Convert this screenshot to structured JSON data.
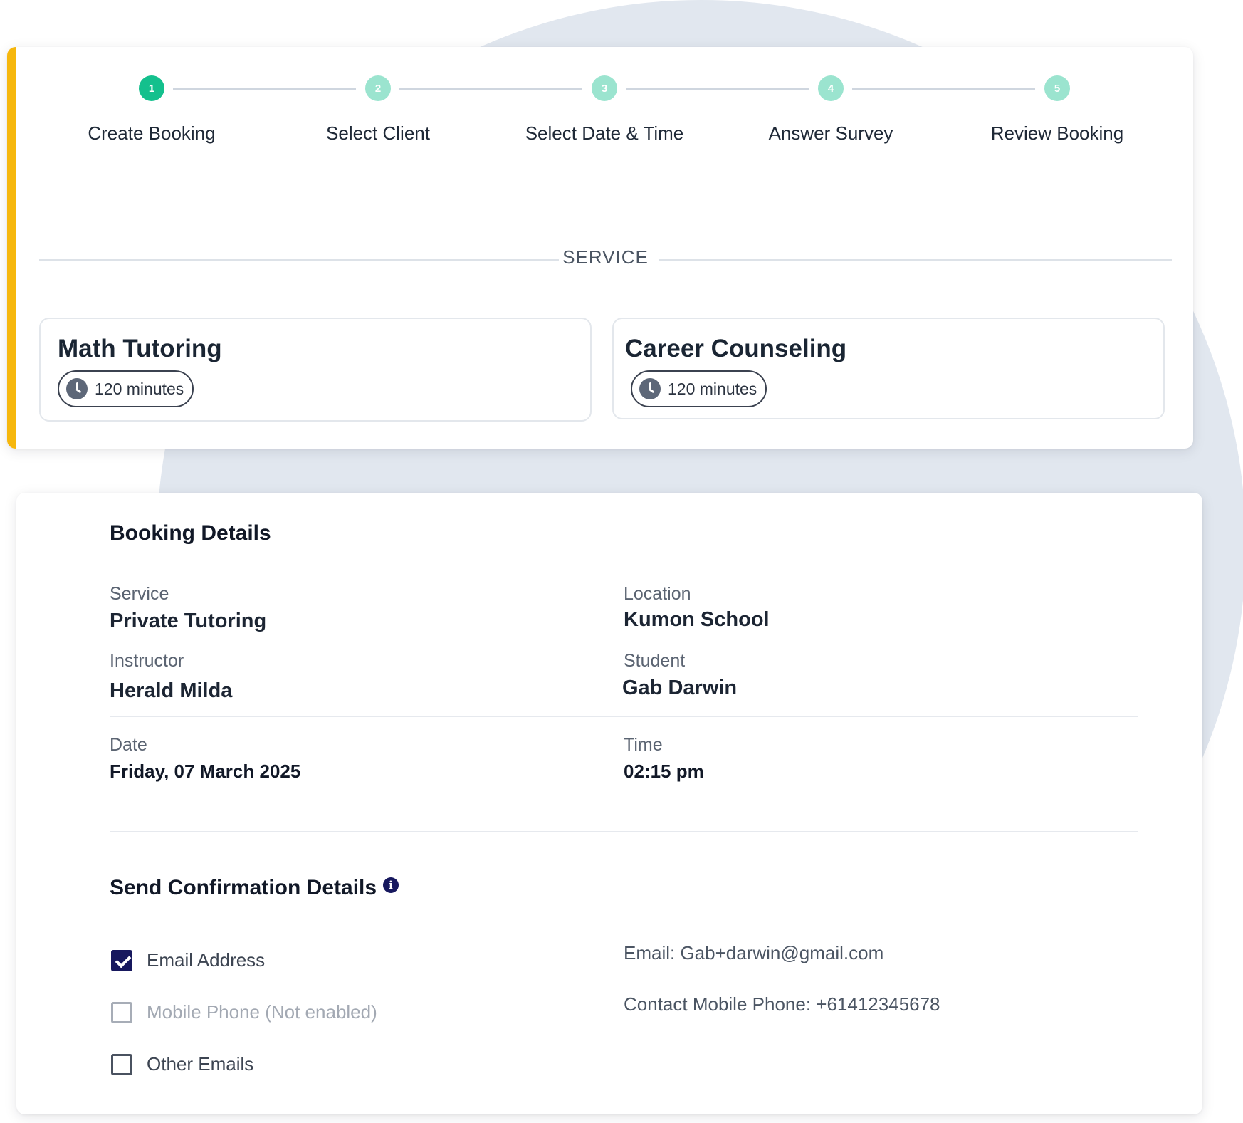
{
  "stepper": {
    "steps": [
      {
        "number": "1",
        "label": "Create Booking",
        "state": "active"
      },
      {
        "number": "2",
        "label": "Select Client",
        "state": "pending"
      },
      {
        "number": "3",
        "label": "Select Date & Time",
        "state": "pending"
      },
      {
        "number": "4",
        "label": "Answer Survey",
        "state": "pending"
      },
      {
        "number": "5",
        "label": "Review Booking",
        "state": "pending"
      }
    ]
  },
  "service_section": {
    "heading": "SERVICE",
    "services": [
      {
        "title": "Math Tutoring",
        "duration": "120 minutes",
        "icon": "clock-icon"
      },
      {
        "title": "Career Counseling",
        "duration": "120 minutes",
        "icon": "clock-icon"
      }
    ]
  },
  "booking_details": {
    "title": "Booking Details",
    "service_label": "Service",
    "service_value": "Private Tutoring",
    "location_label": "Location",
    "location_value": "Kumon School",
    "instructor_label": "Instructor",
    "instructor_value": "Herald Milda",
    "student_label": "Student",
    "student_value": "Gab Darwin",
    "date_label": "Date",
    "date_value": "Friday, 07 March 2025",
    "time_label": "Time",
    "time_value": "02:15 pm"
  },
  "confirmation": {
    "title": "Send Confirmation Details",
    "info_icon": "info-icon",
    "options": [
      {
        "label": "Email Address",
        "checked": true,
        "enabled": true
      },
      {
        "label": "Mobile Phone (Not enabled)",
        "checked": false,
        "enabled": false
      },
      {
        "label": "Other Emails",
        "checked": false,
        "enabled": true
      }
    ],
    "email_line": "Email: Gab+darwin@gmail.com",
    "phone_line": "Contact Mobile Phone: +61412345678"
  },
  "colors": {
    "accent_bar": "#f6b70d",
    "step_active": "#14c08d",
    "step_pending": "#9be4cf",
    "checkbox_checked": "#17185e",
    "background_circle": "#e1e7ef"
  }
}
